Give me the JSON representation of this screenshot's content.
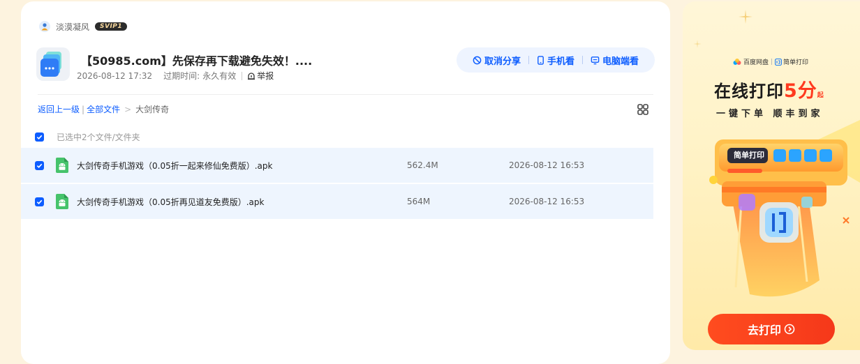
{
  "owner": {
    "name": "淡漠凝风",
    "badge": "SVIP1"
  },
  "share": {
    "title": "【50985.com】先保存再下载避免失效！....",
    "date": "2026-08-12 17:32",
    "expire_label": "过期时间:",
    "expire_value": "永久有效",
    "report_label": "举报"
  },
  "actions": {
    "cancel_share": "取消分享",
    "mobile_view": "手机看",
    "pc_view": "电脑端看"
  },
  "breadcrumb": {
    "back": "返回上一级",
    "all_files": "全部文件",
    "current": "大剑传奇"
  },
  "selection": {
    "text": "已选中2个文件/文件夹"
  },
  "files": [
    {
      "name": "大剑传奇手机游戏（0.05折一起来修仙免费版）.apk",
      "size": "562.4M",
      "time": "2026-08-12 16:53"
    },
    {
      "name": "大剑传奇手机游戏（0.05折再见道友免费版）.apk",
      "size": "564M",
      "time": "2026-08-12 16:53"
    }
  ],
  "ad": {
    "brand_1": "百度网盘",
    "brand_2": "简单打印",
    "title": "在线打印",
    "price": "5分",
    "price_suffix": "起",
    "subtitle": "一键下单  顺丰到家",
    "art_label": "简单打印",
    "button": "去打印"
  },
  "colors": {
    "accent": "#0d5dff",
    "row_bg": "#eef5fe",
    "ad_button": "#f5381a",
    "page_bg": "#fdf3df"
  }
}
